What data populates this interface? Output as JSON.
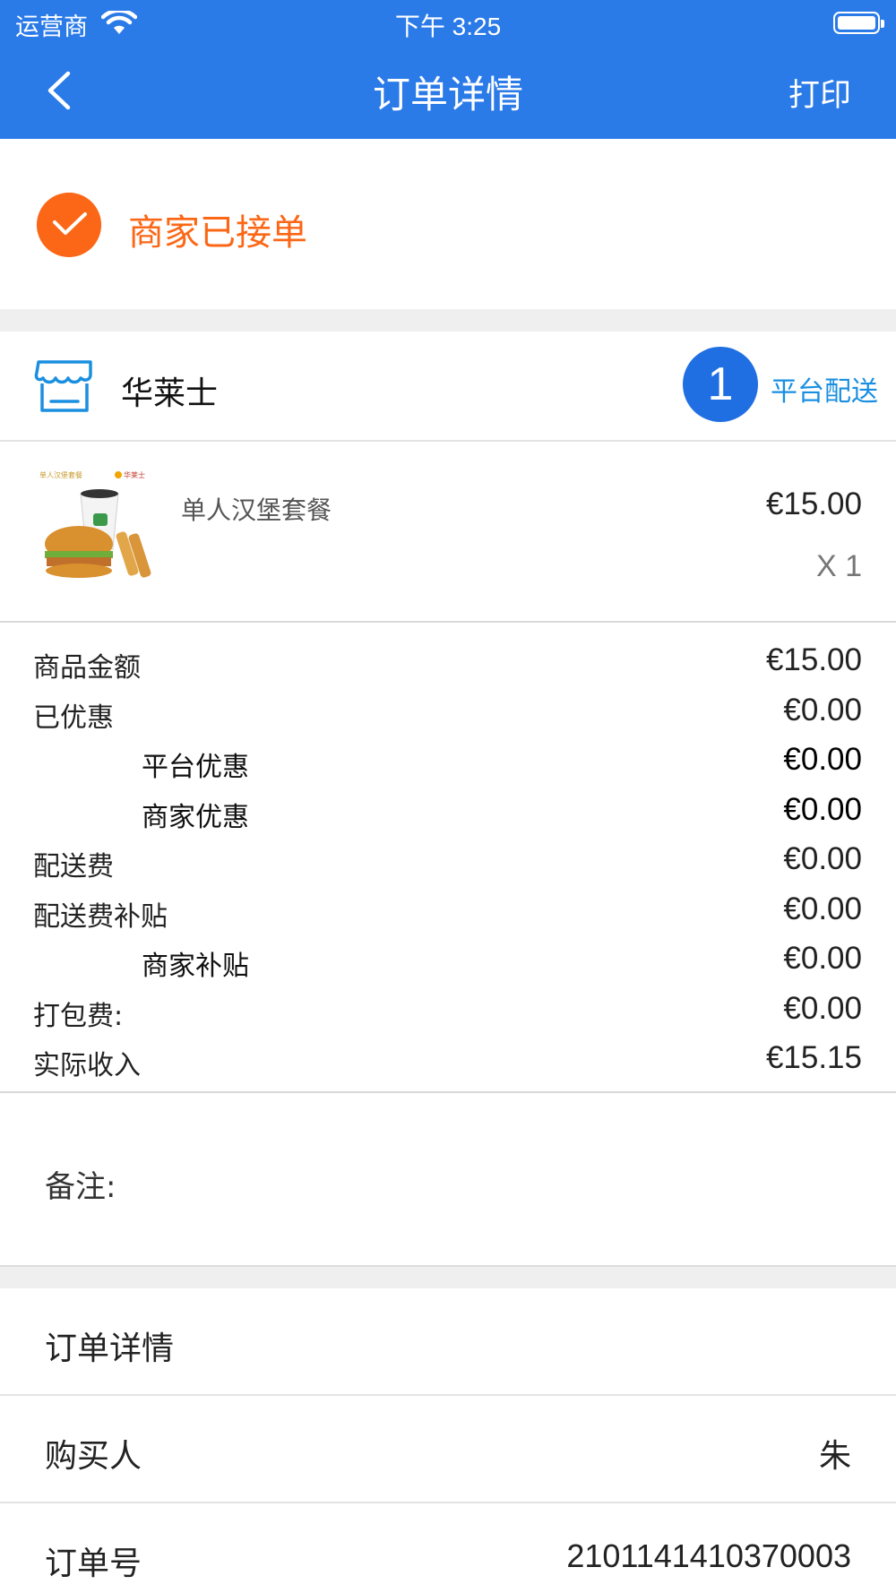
{
  "status_bar": {
    "carrier": "运营商",
    "time": "下午 3:25"
  },
  "nav": {
    "title": "订单详情",
    "print_label": "打印",
    "back_icon": "chevron-left-icon"
  },
  "order_status": {
    "text": "商家已接单",
    "color": "#fb6716"
  },
  "shop": {
    "name": "华莱士",
    "badge_number": "1",
    "delivery_type": "平台配送"
  },
  "item": {
    "name": "单人汉堡套餐",
    "price": "€15.00",
    "quantity": "X 1",
    "image_text": {
      "left": "单人汉堡套餐",
      "brand": "华莱士"
    }
  },
  "fees": [
    {
      "label": "商品金额",
      "value": "€15.00"
    },
    {
      "label": "已优惠",
      "value": "€0.00"
    },
    {
      "label": "平台优惠",
      "value": "€0.00"
    },
    {
      "label": "商家优惠",
      "value": "€0.00"
    },
    {
      "label": "配送费",
      "value": "€0.00"
    },
    {
      "label": "配送费补贴",
      "value": "€0.00"
    },
    {
      "label": "商家补贴",
      "value": "€0.00"
    },
    {
      "label": "打包费:",
      "value": "€0.00"
    },
    {
      "label": "实际收入",
      "value": "€15.15"
    }
  ],
  "note": {
    "label": "备注:"
  },
  "details": {
    "title": "订单详情",
    "rows": [
      {
        "label": "购买人",
        "value": "朱"
      },
      {
        "label": "订单号",
        "value": "2101141410370003"
      }
    ]
  },
  "colors": {
    "header": "#2a7ae8",
    "accent_orange": "#fb6716",
    "badge_blue": "#1f6fe3",
    "link_blue": "#1a8fe0"
  }
}
